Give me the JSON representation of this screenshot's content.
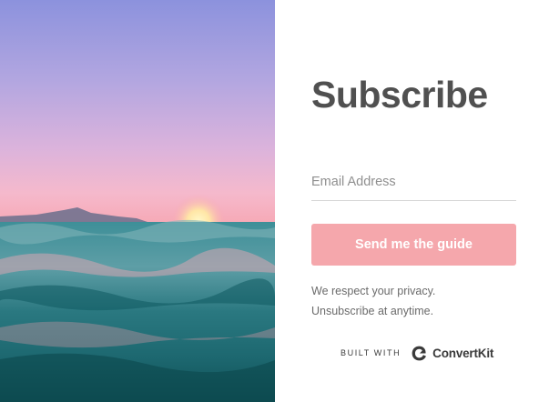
{
  "hero": {
    "image_name": "ocean-sunset-photo"
  },
  "form": {
    "title": "Subscribe",
    "email_placeholder": "Email Address",
    "email_value": "",
    "submit_label": "Send me the guide",
    "privacy_line1": "We respect your privacy.",
    "privacy_line2": "Unsubscribe at anytime."
  },
  "footer": {
    "built_with": "BUILT WITH",
    "brand": "ConvertKit",
    "brand_icon": "convertkit-logo-icon"
  },
  "colors": {
    "button": "#f5a7ac",
    "title": "#505050",
    "muted_text": "#6b6b6b",
    "sky_top": "#8c92dd",
    "sky_bottom": "#f3b4c5",
    "ocean": "#1f6f76"
  }
}
